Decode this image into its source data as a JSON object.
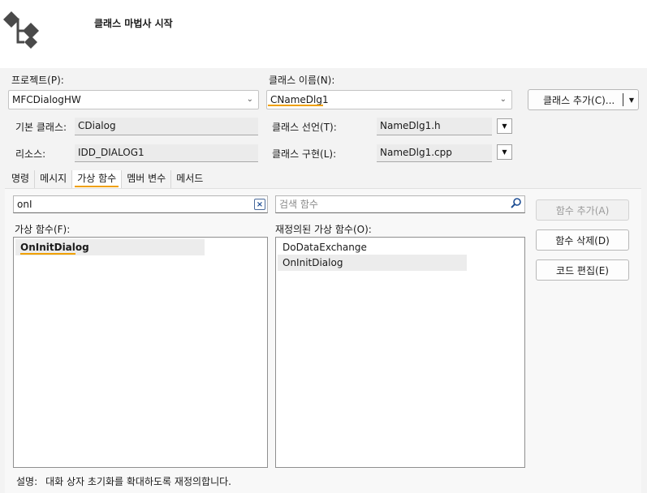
{
  "header": {
    "title": "클래스 마법사 시작"
  },
  "project": {
    "label": "프로젝트(P):",
    "value": "MFCDialogHW"
  },
  "class_name": {
    "label": "클래스 이름(N):",
    "value": "CNameDlg1"
  },
  "add_class_button": {
    "label": "클래스 추가(C)..."
  },
  "base_class": {
    "label": "기본 클래스:",
    "value": "CDialog"
  },
  "resource": {
    "label": "리소스:",
    "value": "IDD_DIALOG1"
  },
  "class_declaration": {
    "label": "클래스 선언(T):",
    "value": "NameDlg1.h"
  },
  "class_implementation": {
    "label": "클래스 구현(L):",
    "value": "NameDlg1.cpp"
  },
  "tabs": [
    {
      "label": "명령",
      "active": false
    },
    {
      "label": "메시지",
      "active": false
    },
    {
      "label": "가상 함수",
      "active": true
    },
    {
      "label": "멤버 변수",
      "active": false
    },
    {
      "label": "메서드",
      "active": false
    }
  ],
  "filter": {
    "value": "onI"
  },
  "search": {
    "placeholder": "검색 함수"
  },
  "virtual_functions": {
    "label": "가상 함수(F):",
    "items": [
      "OnInitDialog"
    ]
  },
  "overridden_functions": {
    "label": "재정의된 가상 함수(O):",
    "items": [
      "DoDataExchange",
      "OnInitDialog"
    ]
  },
  "buttons": {
    "add_function": "함수 추가(A)",
    "delete_function": "함수 삭제(D)",
    "edit_code": "코드 편집(E)"
  },
  "description": {
    "label": "설명:",
    "text": "대화 상자 초기화를 확대하도록 재정의합니다."
  },
  "colors": {
    "accent": "#f0a000",
    "header_bg": "#ffffff",
    "dialog_bg": "#f3f3f3"
  }
}
